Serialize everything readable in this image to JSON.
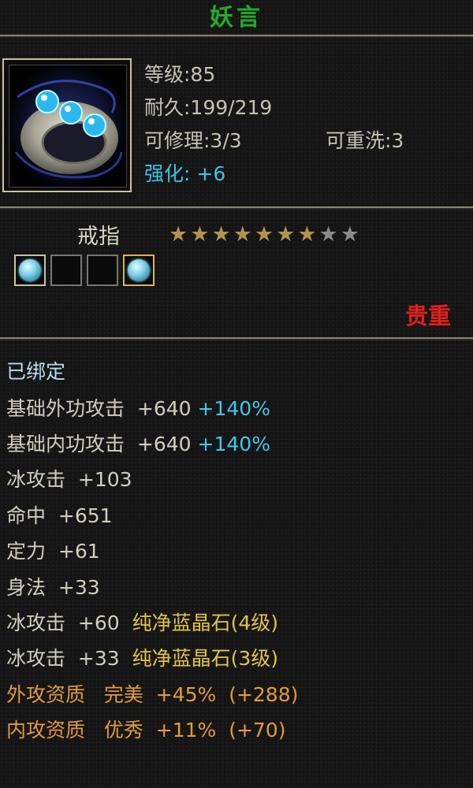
{
  "item_name": "妖言",
  "stats": {
    "level": "等级:85",
    "durability": "耐久:199/219",
    "repairable": "可修理:3/3",
    "rewash": "可重洗:3",
    "enhance": "强化: +6"
  },
  "item_type": "戒指",
  "stars": {
    "filled": 7,
    "total": 9
  },
  "sockets": [
    "gem",
    "empty",
    "empty",
    "gem"
  ],
  "rarity": "贵重",
  "bound": "已绑定",
  "attributes": [
    {
      "name": "基础外功攻击",
      "value": "+640",
      "extra": "+140%"
    },
    {
      "name": "基础内功攻击",
      "value": "+640",
      "extra": "+140%"
    },
    {
      "name": "冰攻击",
      "value": "+103"
    },
    {
      "name": "命中",
      "value": "+651"
    },
    {
      "name": "定力",
      "value": "+61"
    },
    {
      "name": "身法",
      "value": "+33"
    }
  ],
  "gem_lines": [
    {
      "name": "冰攻击",
      "value": "+60",
      "gem": "纯净蓝晶石(4级)"
    },
    {
      "name": "冰攻击",
      "value": "+33",
      "gem": "纯净蓝晶石(3级)"
    }
  ],
  "qualities": [
    {
      "name": "外攻资质",
      "grade": "完美",
      "pct": "+45%",
      "bonus": "(+288)"
    },
    {
      "name": "内攻资质",
      "grade": "优秀",
      "pct": "+11%",
      "bonus": "(+70)"
    }
  ],
  "colors": {
    "title": "#1fae2a",
    "rarity": "#e0201a",
    "enhance": "#39c5e6",
    "quality": "#e39a3c",
    "gem": "#e2c34a"
  }
}
